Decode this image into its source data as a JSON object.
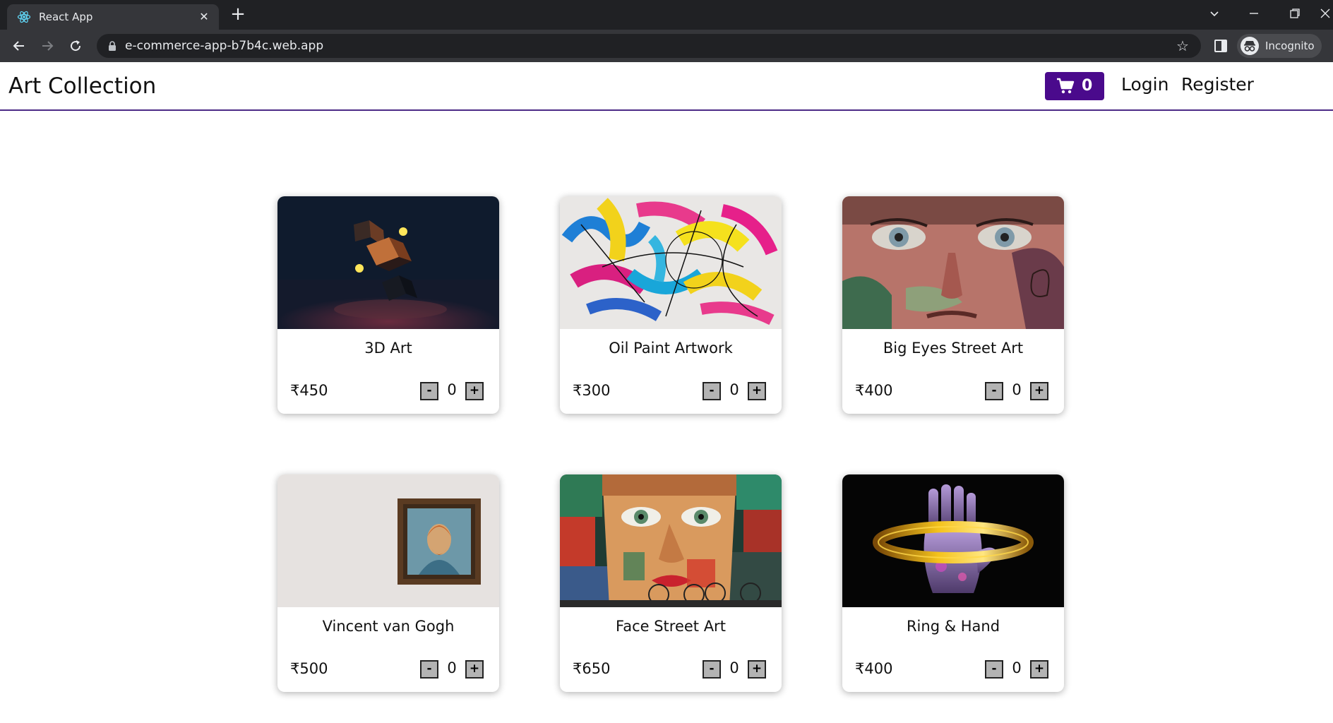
{
  "browser": {
    "tab_title": "React App",
    "url": "e-commerce-app-b7b4c.web.app",
    "profile_label": "Incognito"
  },
  "header": {
    "brand": "Art Collection",
    "cart_count": "0",
    "login_label": "Login",
    "register_label": "Register",
    "accent_color": "#4a0a8c"
  },
  "products": [
    {
      "title": "3D Art",
      "price": "₹450",
      "qty": "0",
      "minus": "-",
      "plus": "+"
    },
    {
      "title": "Oil Paint Artwork",
      "price": "₹300",
      "qty": "0",
      "minus": "-",
      "plus": "+"
    },
    {
      "title": "Big Eyes Street Art",
      "price": "₹400",
      "qty": "0",
      "minus": "-",
      "plus": "+"
    },
    {
      "title": "Vincent van Gogh",
      "price": "₹500",
      "qty": "0",
      "minus": "-",
      "plus": "+"
    },
    {
      "title": "Face Street Art",
      "price": "₹650",
      "qty": "0",
      "minus": "-",
      "plus": "+"
    },
    {
      "title": "Ring & Hand",
      "price": "₹400",
      "qty": "0",
      "minus": "-",
      "plus": "+"
    }
  ]
}
